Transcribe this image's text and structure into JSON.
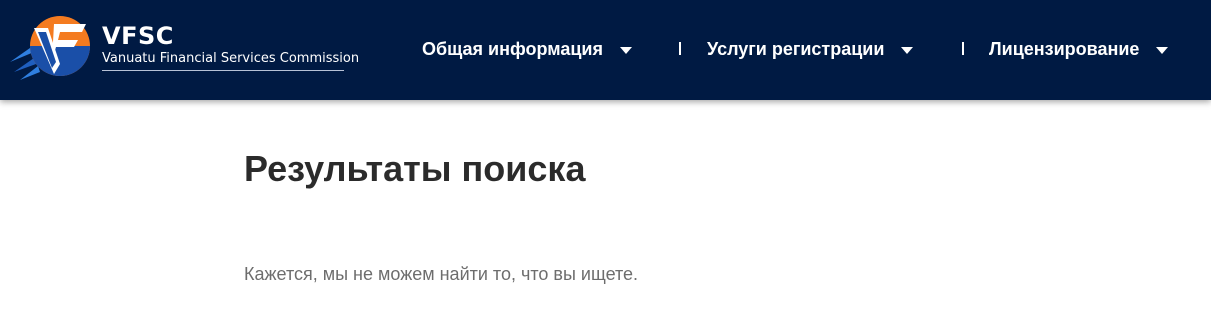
{
  "header": {
    "logo": {
      "title": "VFSC",
      "subtitle": "Vanuatu Financial Services Commission"
    },
    "nav": [
      {
        "label": "Общая информация"
      },
      {
        "label": "Услуги регистрации"
      },
      {
        "label": "Лицензирование"
      }
    ]
  },
  "main": {
    "title": "Результаты поиска",
    "message": "Кажется, мы не можем найти то, что вы ищете."
  },
  "colors": {
    "header_bg": "#001a43",
    "logo_orange": "#f47b20",
    "logo_blue": "#1f5fbf",
    "title_text": "#2b2b2b",
    "body_text": "#6d6d6d"
  },
  "icons": [
    "vfsc-logo-icon",
    "chevron-down-icon"
  ]
}
